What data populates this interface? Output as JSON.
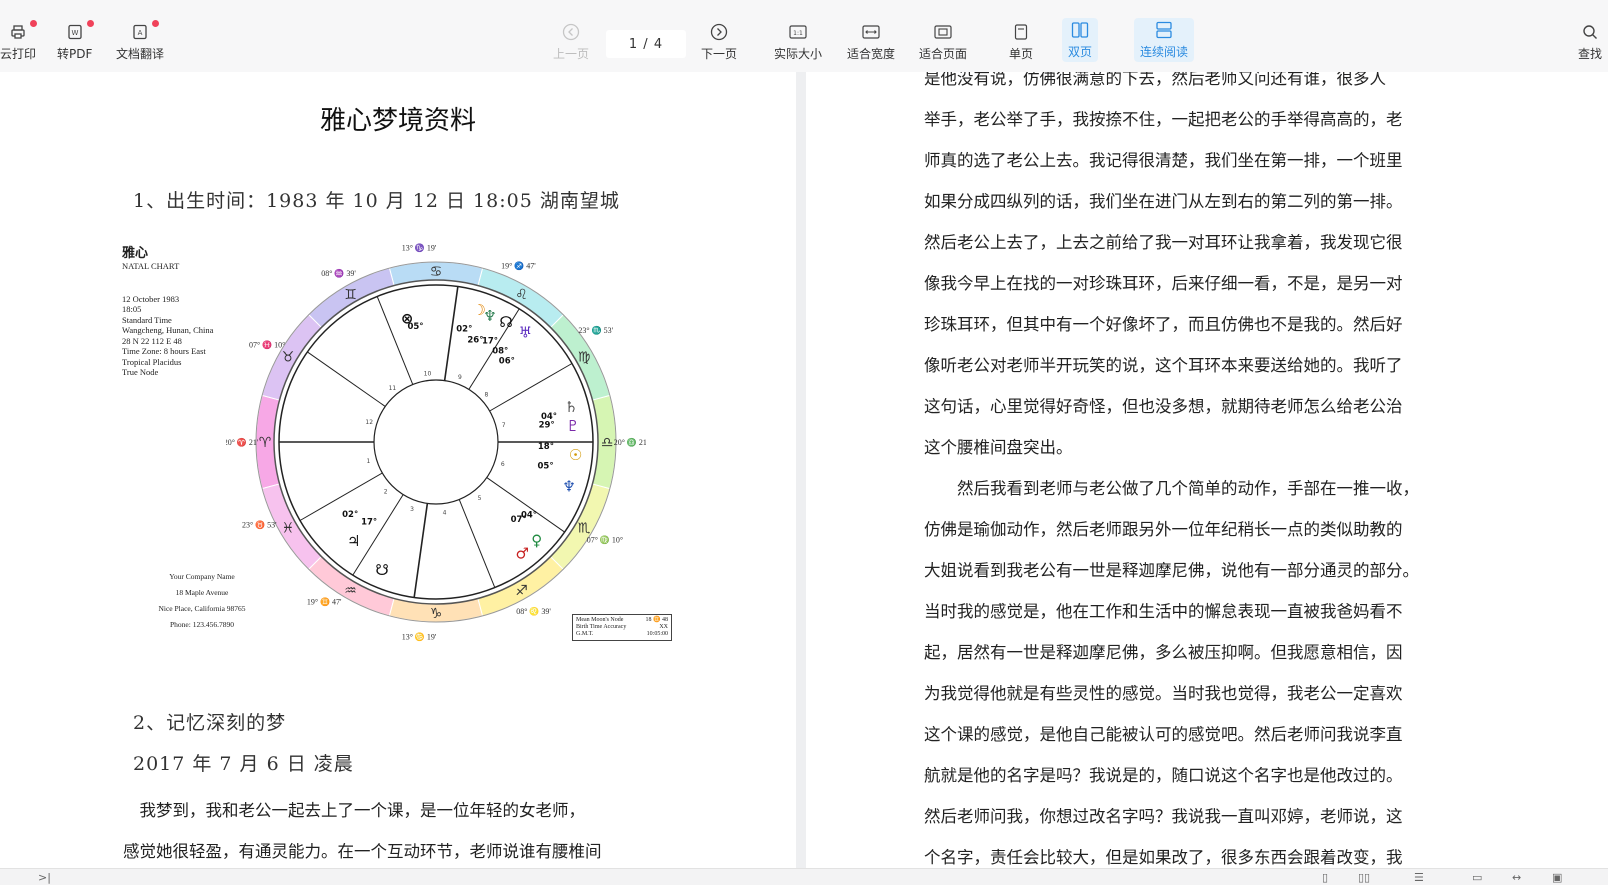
{
  "toolbar": {
    "left": [
      {
        "label": "云打印",
        "icon": "printer-icon"
      },
      {
        "label": "转PDF",
        "icon": "pdf-icon"
      },
      {
        "label": "文档翻译",
        "icon": "translate-icon"
      }
    ],
    "prev_label": "上一页",
    "page_indicator": "1 / 4",
    "next_label": "下一页",
    "actual_size_label": "实际大小",
    "actual_size_glyph": "1:1",
    "fit_width_label": "适合宽度",
    "fit_page_label": "适合页面",
    "single_label": "单页",
    "double_label": "双页",
    "continuous_label": "连续阅读",
    "search_label": "查找",
    "accent": "#2b8be0"
  },
  "left_page": {
    "title": "雅心梦境资料",
    "section1": "1、出生时间：1983 年 10 月 12 日 18:05  湖南望城",
    "chart": {
      "name": "雅心",
      "subtitle": "NATAL CHART",
      "lines": [
        "12 October 1983",
        "18:05",
        "Standard Time",
        "Wangcheng, Hunan, China",
        "28 N 22     112 E 48",
        "Time Zone: 8 hours East",
        "Tropical Placidus",
        "True Node"
      ],
      "company": [
        "Your Company Name",
        "18 Maple Avenue",
        "Nice Place, California 98765",
        "Phone: 123.456.7890"
      ],
      "node_box": [
        [
          "Mean Moon's Node",
          "18 ♊ 48"
        ],
        [
          "Birth Time Accuracy",
          "XX"
        ],
        [
          "G.M.T.",
          "10:05:00"
        ]
      ]
    },
    "section2": "2、记忆深刻的梦",
    "section3": "2017 年 7 月 6 日  凌晨",
    "paragraph": [
      "　我梦到，我和老公一起去上了一个课，是一位年轻的女老师，",
      "感觉她很轻盈，有通灵能力。在一个互动环节，老师说谁有腰椎间"
    ]
  },
  "right_page": {
    "lines": [
      "是他没有说，仿佛很满意的下去，然后老师又问还有谁，很多人",
      "举手，老公举了手，我按捺不住，一起把老公的手举得高高的，老",
      "师真的选了老公上去。我记得很清楚，我们坐在第一排，一个班里",
      "如果分成四纵列的话，我们坐在进门从左到右的第二列的第一排。",
      "然后老公上去了，上去之前给了我一对耳环让我拿着，我发现它很",
      "像我今早上在找的一对珍珠耳环，后来仔细一看，不是，是另一对",
      "珍珠耳环，但其中有一个好像坏了，而且仿佛也不是我的。然后好",
      "像听老公对老师半开玩笑的说，这个耳环本来要送给她的。我听了",
      "这句话，心里觉得好奇怪，但也没多想，就期待老师怎么给老公治",
      "这个腰椎间盘突出。",
      "　　然后我看到老师与老公做了几个简单的动作，手部在一推一收，",
      "仿佛是瑜伽动作，然后老师跟另外一位年纪稍长一点的类似助教的",
      "大姐说看到我老公有一世是释迦摩尼佛，说他有一部分通灵的部分。",
      "当时我的感觉是，他在工作和生活中的懈怠表现一直被我爸妈看不",
      "起，居然有一世是释迦摩尼佛，多么被压抑啊。但我愿意相信，因",
      "为我觉得他就是有些灵性的感觉。当时我也觉得，我老公一定喜欢",
      "这个课的感觉，是他自己能被认可的感觉吧。然后老师问我说李直",
      "航就是他的名字是吗？我说是的，随口说这个名字也是他改过的。",
      "然后老师问我，你想过改名字吗？我说我一直叫邓婷，老师说，这",
      "个名字，责任会比较大，但是如果改了，很多东西会跟着改变，我"
    ]
  },
  "wheel": {
    "signs": [
      "♈",
      "♉",
      "♊",
      "♋",
      "♌",
      "♍",
      "♎",
      "♏",
      "♐",
      "♑",
      "♒",
      "♓"
    ],
    "outer_labels": [
      "13° ♑ 19'",
      "19° ♐ 47'",
      "23° ♏ 53'",
      "20° ♎ 21'",
      "07° ♍ 10°",
      "08° ♌ 39'",
      "13° ♋ 19'",
      "19° ♊ 47'",
      "23° ♉ 53'",
      "20° ♈ 21'",
      "07° ♓ 10°",
      "08° ♒ 39'"
    ],
    "planets": [
      "☽",
      "♆",
      "☊",
      "♅",
      "♄",
      "♇",
      "☉",
      "♆",
      "♂",
      "♀",
      "☿",
      "♃",
      "♄",
      "☋",
      "⊗"
    ],
    "planet_degrees": [
      "02°",
      "26°",
      "17°",
      "08°",
      "06°",
      "04°",
      "29°",
      "18°",
      "05°",
      "07°",
      "04°",
      "02°",
      "17°",
      "05°"
    ]
  }
}
